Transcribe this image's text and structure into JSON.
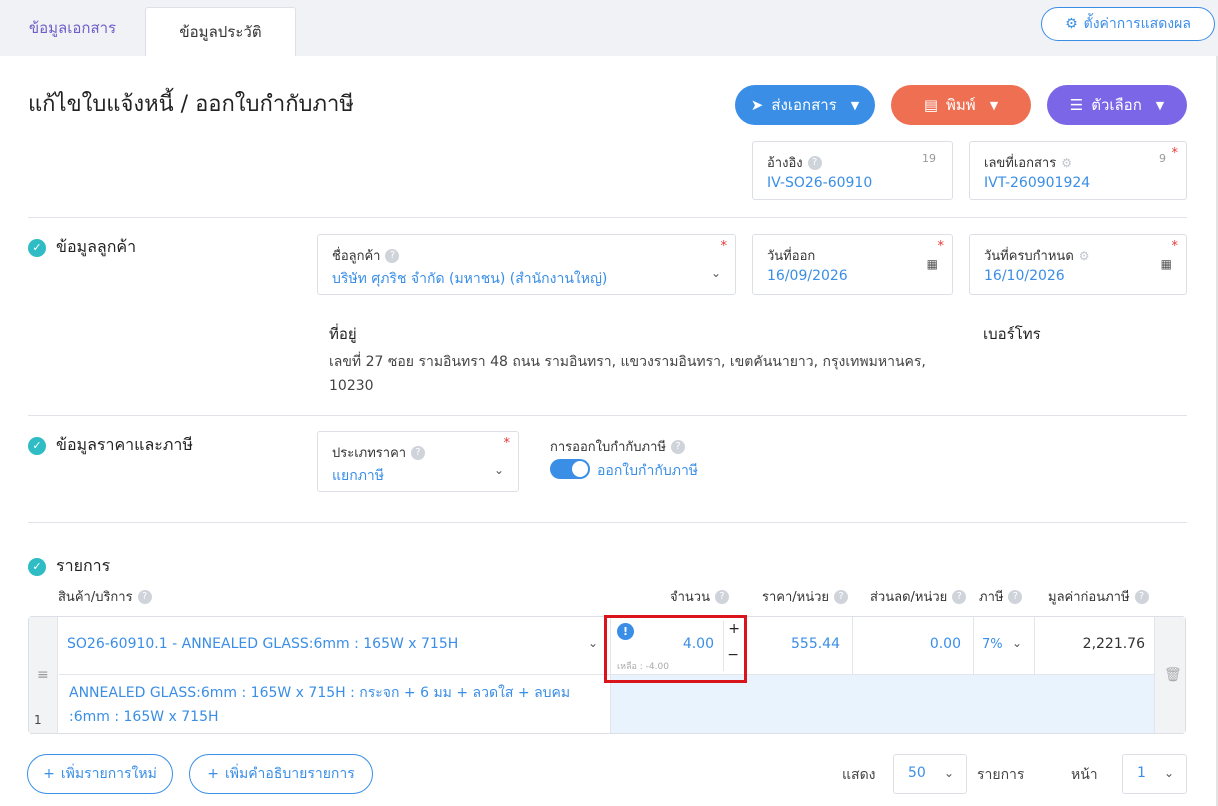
{
  "tabs": [
    {
      "label": "ข้อมูลเอกสาร",
      "active": true
    },
    {
      "label": "ข้อมูลประวัติ",
      "active": false
    }
  ],
  "display_settings_label": "ตั้งค่าการแสดงผล",
  "page_title": "แก้ไขใบแจ้งหนี้ / ออกใบกำกับภาษี",
  "header_buttons": {
    "send": "ส่งเอกสาร",
    "print": "พิมพ์",
    "options": "ตัวเลือก"
  },
  "reference": {
    "label": "อ้างอิง",
    "count": "19",
    "value": "IV-SO26-60910"
  },
  "doc_number": {
    "label": "เลขที่เอกสาร",
    "count": "9",
    "value": "IVT-260901924"
  },
  "customer_section": {
    "title": "ข้อมูลลูกค้า",
    "customer_name": {
      "label": "ชื่อลูกค้า",
      "value": "บริษัท ศุภริช จำกัด (มหาชน) (สำนักงานใหญ่)"
    },
    "issue_date": {
      "label": "วันที่ออก",
      "value": "16/09/2026"
    },
    "due_date": {
      "label": "วันที่ครบกำหนด",
      "value": "16/10/2026"
    },
    "address_label": "ที่อยู่",
    "address_value": "เลขที่ 27 ซอย รามอินทรา 48 ถนน รามอินทรา, แขวงรามอินทรา, เขตคันนายาว, กรุงเทพมหานคร, 10230",
    "phone_label": "เบอร์โทร"
  },
  "pricing_section": {
    "title": "ข้อมูลราคาและภาษี",
    "price_type": {
      "label": "ประเภทราคา",
      "value": "แยกภาษี"
    },
    "tax_invoice_label": "การออกใบกำกับภาษี",
    "tax_invoice_toggle_text": "ออกใบกำกับภาษี",
    "tax_invoice_on": true
  },
  "items_section": {
    "title": "รายการ",
    "columns": {
      "product": "สินค้า/บริการ",
      "quantity": "จำนวน",
      "unit_price": "ราคา/หน่วย",
      "discount": "ส่วนลด/หน่วย",
      "tax": "ภาษี",
      "amount": "มูลค่าก่อนภาษี"
    },
    "rows": [
      {
        "index": "1",
        "product": "SO26-60910.1 - ANNEALED GLASS:6mm : 165W x 715H",
        "description": "ANNEALED GLASS:6mm : 165W x 715H : กระจก + 6 มม + ลวดใส + ลบคม :6mm : 165W x 715H",
        "quantity": "4.00",
        "remaining": "เหลือ : -4.00",
        "unit_price": "555.44",
        "discount": "0.00",
        "tax": "7%",
        "amount": "2,221.76"
      }
    ]
  },
  "footer": {
    "add_item": "เพิ่มรายการใหม่",
    "add_description": "เพิ่มคำอธิบายรายการ",
    "show_label": "แสดง",
    "page_size": "50",
    "items_label": "รายการ",
    "page_label": "หน้า",
    "page_number": "1"
  },
  "colors": {
    "primary": "#3a8ee6",
    "send_button": "#3a8ee6",
    "print_button": "#ef6f52",
    "options_button": "#7a66e6",
    "section_check": "#2fbcc4",
    "highlight_box": "#d9141a"
  }
}
